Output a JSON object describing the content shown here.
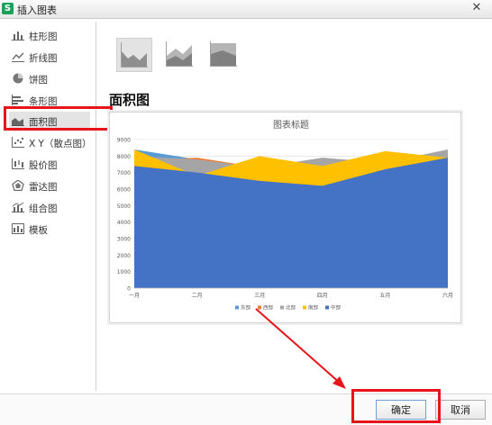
{
  "window": {
    "title": "插入图表",
    "app_icon_letter": "S"
  },
  "sidebar": {
    "items": [
      {
        "label": "柱形图",
        "icon": "column-chart-icon"
      },
      {
        "label": "折线图",
        "icon": "line-chart-icon"
      },
      {
        "label": "饼图",
        "icon": "pie-chart-icon"
      },
      {
        "label": "条形图",
        "icon": "bar-chart-icon"
      },
      {
        "label": "面积图",
        "icon": "area-chart-icon",
        "selected": true
      },
      {
        "label": "X Y（散点图）",
        "icon": "scatter-chart-icon"
      },
      {
        "label": "股价图",
        "icon": "stock-chart-icon"
      },
      {
        "label": "雷达图",
        "icon": "radar-chart-icon"
      },
      {
        "label": "组合图",
        "icon": "combo-chart-icon"
      },
      {
        "label": "模板",
        "icon": "template-icon"
      }
    ]
  },
  "subtypes": [
    {
      "name": "area",
      "selected": true
    },
    {
      "name": "stacked-area",
      "selected": false
    },
    {
      "name": "percent-stacked-area",
      "selected": false
    }
  ],
  "section_title": "面积图",
  "buttons": {
    "ok": "确定",
    "cancel": "取消"
  },
  "colors": {
    "highlight_red": "#e8141b",
    "accent_blue": "#4472c4"
  },
  "chart_data": {
    "type": "area",
    "title": "图表标题",
    "categories": [
      "一月",
      "二月",
      "三月",
      "四月",
      "五月",
      "六月"
    ],
    "ylim": [
      0,
      9000
    ],
    "yticks": [
      0,
      1000,
      2000,
      3000,
      4000,
      5000,
      6000,
      7000,
      8000,
      9000
    ],
    "grid": true,
    "legend_position": "bottom",
    "series": [
      {
        "name": "东部",
        "color": "#5b9bd5",
        "values": [
          8400,
          7800,
          6900,
          7200,
          7600,
          8100
        ]
      },
      {
        "name": "西部",
        "color": "#ed7d31",
        "values": [
          7700,
          7900,
          7300,
          7400,
          8100,
          7900
        ]
      },
      {
        "name": "北部",
        "color": "#a5a5a5",
        "values": [
          8000,
          7800,
          7300,
          7900,
          7600,
          8400
        ]
      },
      {
        "name": "南部",
        "color": "#ffc000",
        "values": [
          8400,
          6800,
          8000,
          7400,
          8300,
          7900
        ]
      },
      {
        "name": "中部",
        "color": "#4472c4",
        "values": [
          7400,
          7000,
          6500,
          6200,
          7200,
          7900
        ]
      }
    ]
  }
}
